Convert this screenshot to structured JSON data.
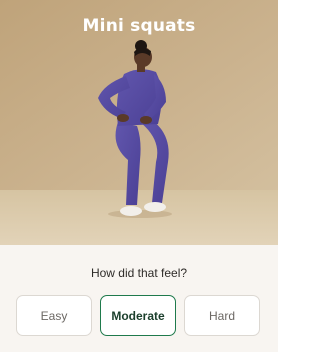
{
  "exercise": {
    "title": "Mini squats",
    "image_icon": "woman-doing-mini-squat-photo"
  },
  "feedback": {
    "question": "How did that feel?",
    "options": [
      {
        "label": "Easy"
      },
      {
        "label": "Moderate"
      },
      {
        "label": "Hard"
      }
    ],
    "selected": "Moderate"
  },
  "colors": {
    "background": "#f8f5f1",
    "accent_green": "#1f7a4c",
    "photo_wall": "#c5ac85",
    "photo_floor": "#dccbab",
    "outfit": "#5b4fa6"
  }
}
